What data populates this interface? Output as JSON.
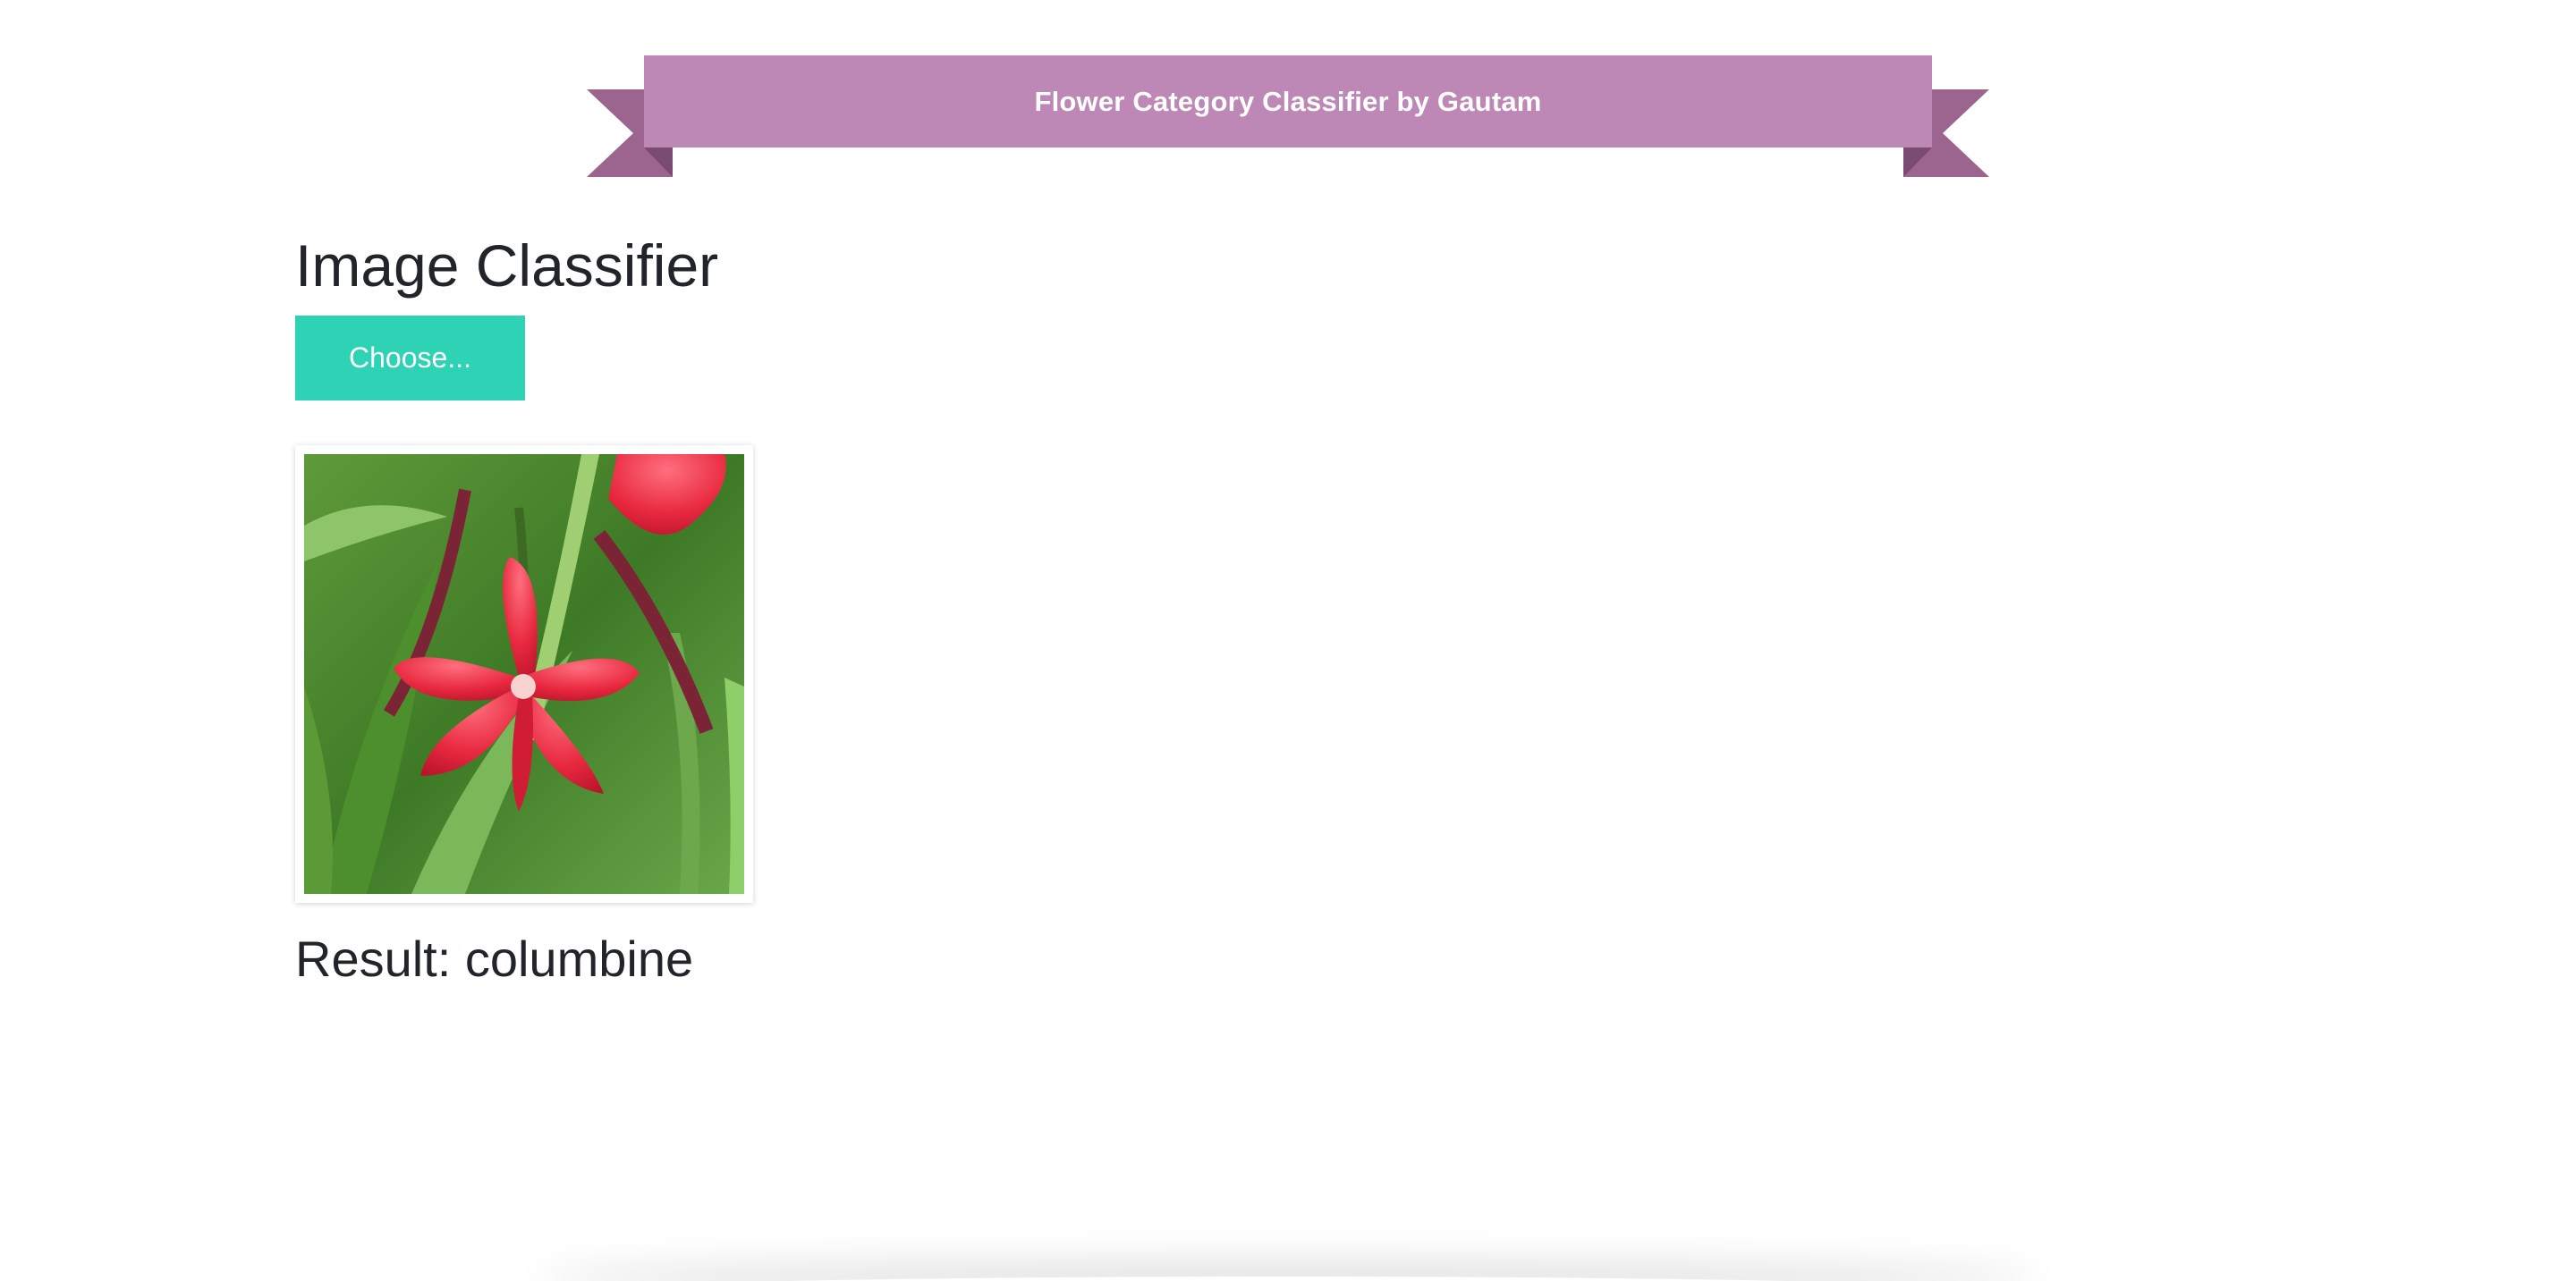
{
  "banner": {
    "title": "Flower Category Classifier by Gautam"
  },
  "main": {
    "heading": "Image Classifier",
    "choose_label": "Choose...",
    "result_label": "Result: columbine"
  },
  "colors": {
    "ribbon": "#bd88b6",
    "ribbon_dark": "#9b6590",
    "ribbon_fold": "#7a4b72",
    "button": "#2ed3b6",
    "text": "#212529"
  },
  "icons": {
    "photo": "flower-photo"
  }
}
